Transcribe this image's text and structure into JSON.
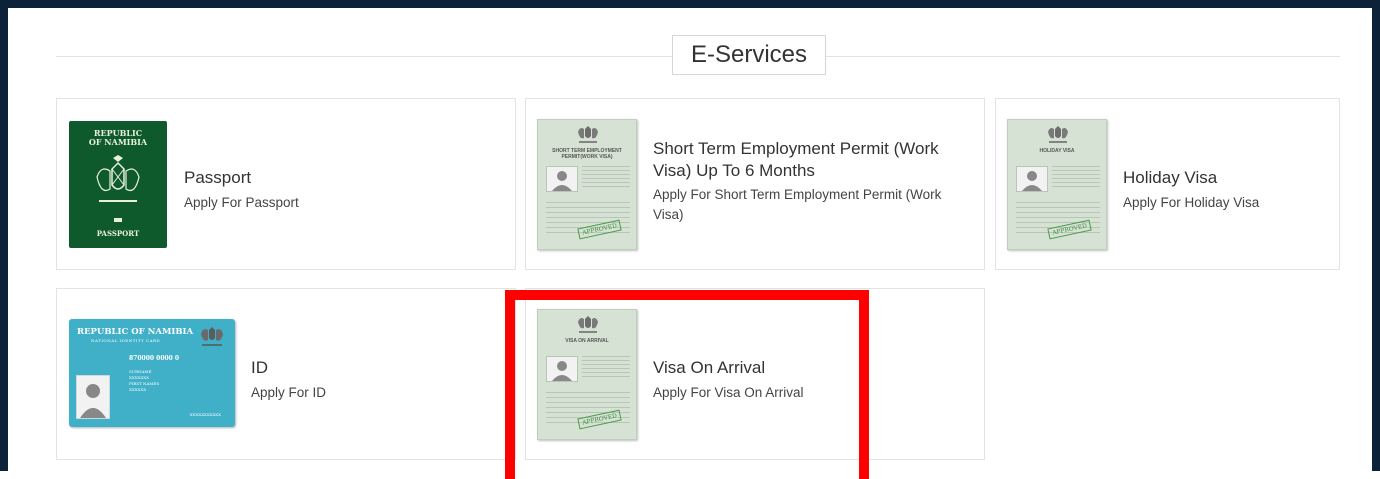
{
  "header": {
    "title": "E-Services"
  },
  "services": [
    {
      "title": "Passport",
      "description": "Apply For Passport",
      "thumb": {
        "top": "REPUBLIC\nOF NAMIBIA",
        "bottom": "PASSPORT"
      }
    },
    {
      "title": "Short Term Employment Permit (Work Visa) Up To 6 Months",
      "description": "Apply For Short Term Employment Permit (Work Visa)",
      "thumb": {
        "doc_title": "SHORT TERM EMPLOYMENT PERMIT(WORK VISA)",
        "stamp": "APPROVED"
      }
    },
    {
      "title": "Holiday Visa",
      "description": "Apply For Holiday Visa",
      "thumb": {
        "doc_title": "HOLIDAY VISA",
        "stamp": "APPROVED"
      }
    },
    {
      "title": "ID",
      "description": "Apply For ID",
      "thumb": {
        "top": "REPUBLIC OF NAMIBIA",
        "sub": "NATIONAL IDENTITY CARD",
        "number": "870000 0000 0",
        "info": "SURNAME\nXXXXXXX\nFIRST NAMES\nXXXXXX",
        "signature": "XXXXXXXXXXX"
      }
    },
    {
      "title": "Visa On Arrival",
      "description": "Apply For Visa On Arrival",
      "thumb": {
        "doc_title": "VISA ON ARRIVAL",
        "stamp": "APPROVED"
      }
    }
  ],
  "colors": {
    "page_border": "#0b2238",
    "highlight": "#ff0000",
    "passport": "#0f5a2d",
    "id_card": "#3fb0c8",
    "document": "#d6e3d4"
  }
}
